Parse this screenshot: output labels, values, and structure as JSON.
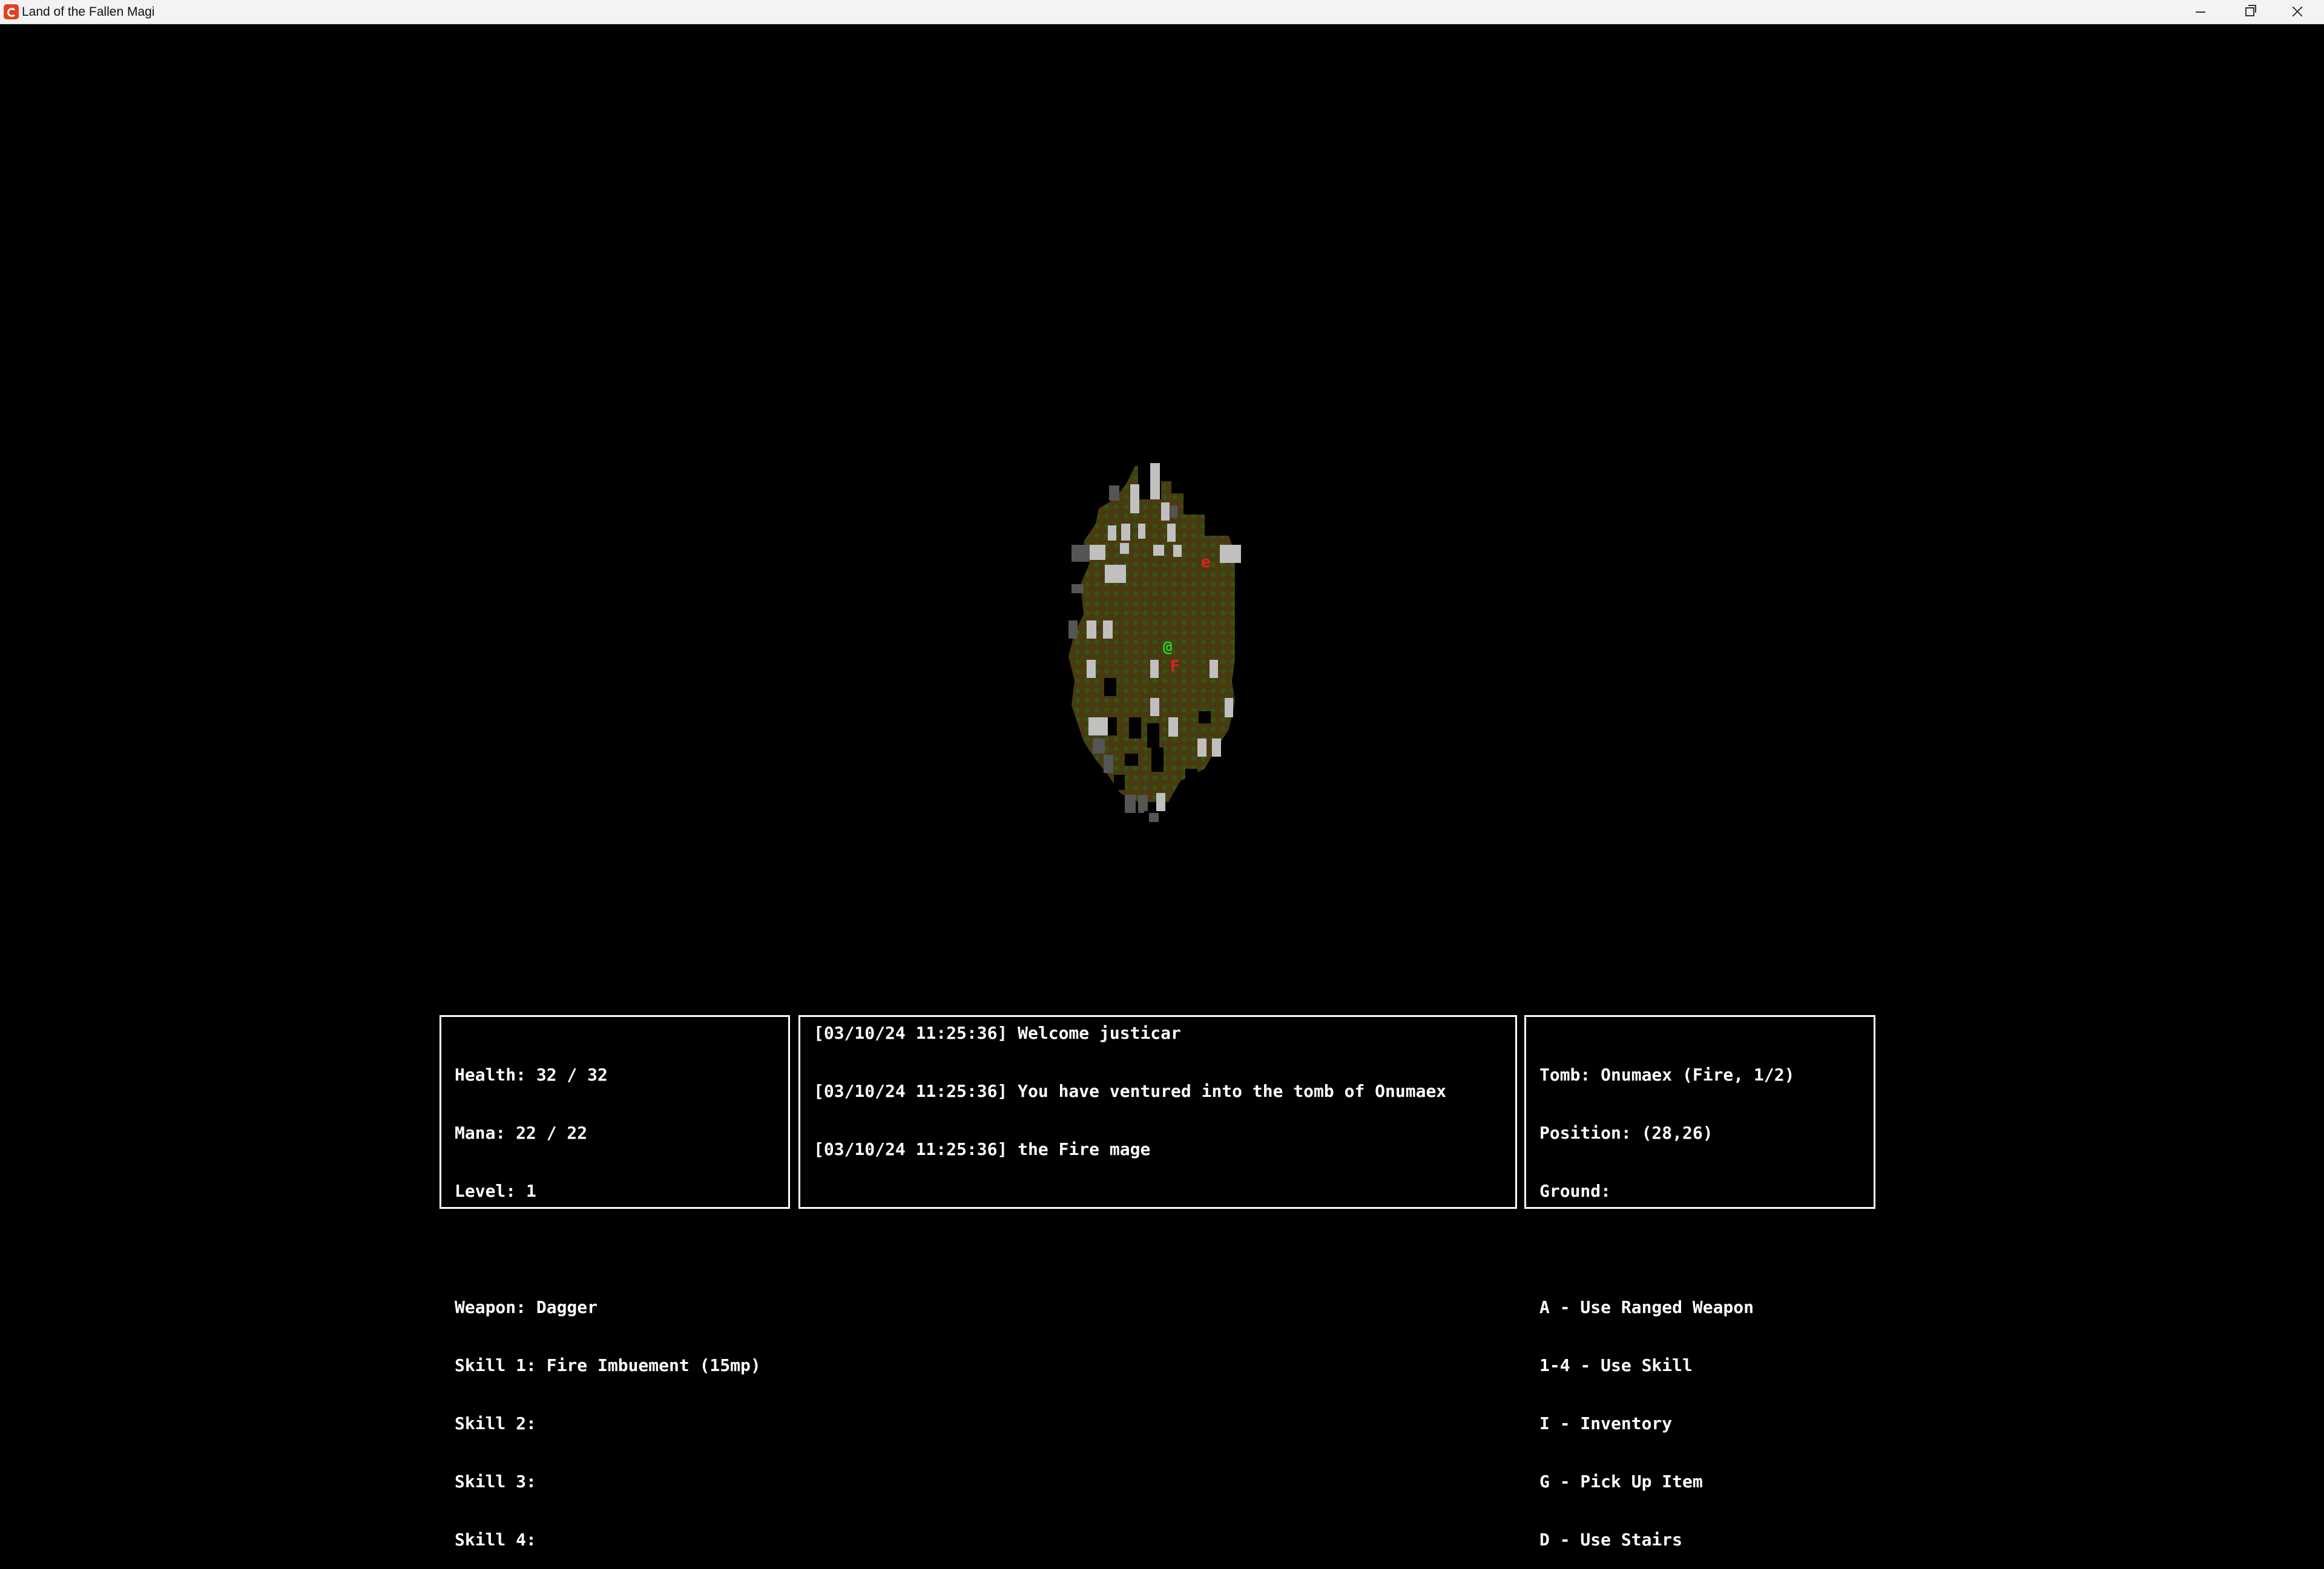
{
  "window": {
    "title": "Land of the Fallen Magi",
    "app_icon": "monogame-icon",
    "controls": [
      "minimize-icon",
      "restore-icon",
      "close-icon"
    ]
  },
  "colors": {
    "background": "#000000",
    "floor": "#4a3a10",
    "floor_pattern": "#2c5a1a",
    "wall_light": "#bdbdbd",
    "wall_dark": "#4a4a4a",
    "player": "#27d327",
    "enemy": "#e01e1e",
    "panel_border": "#ffffff",
    "text": "#ffffff"
  },
  "map": {
    "player_glyph": "@",
    "enemy_glyph": "F",
    "enemy_small_glyph": "e"
  },
  "stats": {
    "health": "Health: 32 / 32",
    "mana": "Mana: 22 / 22",
    "level": "Level: 1",
    "weapon": "Weapon: Dagger",
    "skill1": "Skill 1: Fire Imbuement (15mp)",
    "skill2": "Skill 2:",
    "skill3": "Skill 3:",
    "skill4": "Skill 4:"
  },
  "log": {
    "lines": [
      "[03/10/24 11:25:36] Welcome justicar",
      "[03/10/24 11:25:36] You have ventured into the tomb of Onumaex",
      "[03/10/24 11:25:36] the Fire mage"
    ]
  },
  "info": {
    "tomb": "Tomb: Onumaex (Fire, 1/2)",
    "position": "Position: (28,26)",
    "ground": "Ground:",
    "controls": [
      "A - Use Ranged Weapon",
      "1-4 - Use Skill",
      "I - Inventory",
      "G - Pick Up Item",
      "D - Use Stairs"
    ]
  }
}
